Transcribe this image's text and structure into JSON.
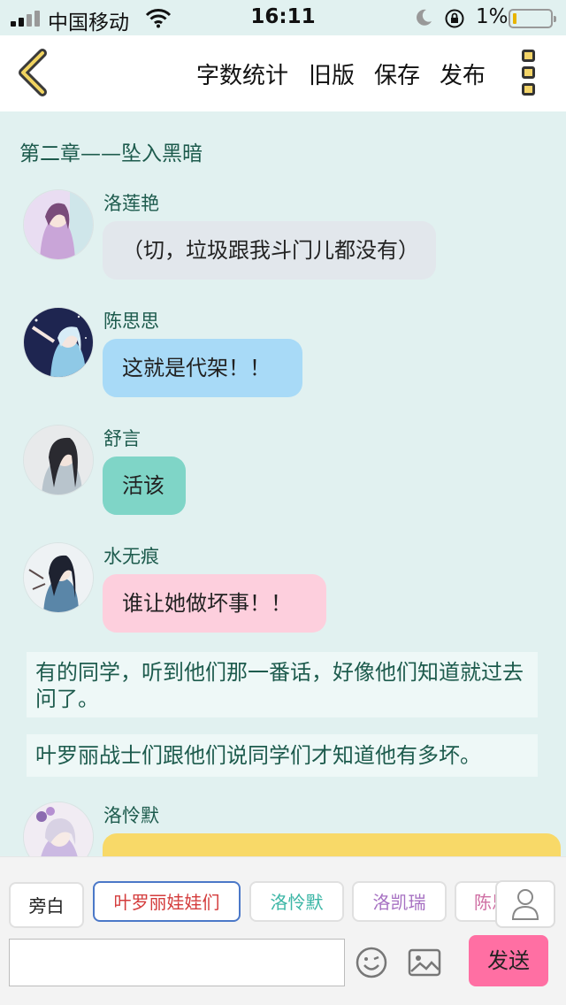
{
  "status_bar": {
    "carrier": "中国移动",
    "time": "16:11",
    "battery_percent": "1%",
    "battery_level": 0.01
  },
  "header": {
    "buttons": [
      {
        "label": "字数统计"
      },
      {
        "label": "旧版"
      },
      {
        "label": "保存"
      },
      {
        "label": "发布"
      }
    ]
  },
  "chapter_title": "第二章——坠入黑暗",
  "messages": [
    {
      "name": "洛莲艳",
      "text": "（切，垃圾跟我斗门儿都没有）",
      "color": "#e2e7ec"
    },
    {
      "name": "陈思思",
      "text": "这就是代架！！",
      "color": "#a8daf7"
    },
    {
      "name": "舒言",
      "text": "活该",
      "color": "#7fd5c7"
    },
    {
      "name": "水无痕",
      "text": "谁让她做坏事！！",
      "color": "#fdcfdd"
    },
    {
      "name": "洛怜默",
      "text": "",
      "color": "#f8d968"
    }
  ],
  "narrations": [
    "有的同学，听到他们那一番话，好像他们知道就过去问了。",
    "叶罗丽战士们跟他们说同学们才知道他有多坏。"
  ],
  "bottom": {
    "narrator_label": "旁白",
    "characters": [
      "叶罗丽娃娃们",
      "洛怜默",
      "洛凯瑞",
      "陈思"
    ],
    "input_value": "",
    "send_label": "发送"
  }
}
